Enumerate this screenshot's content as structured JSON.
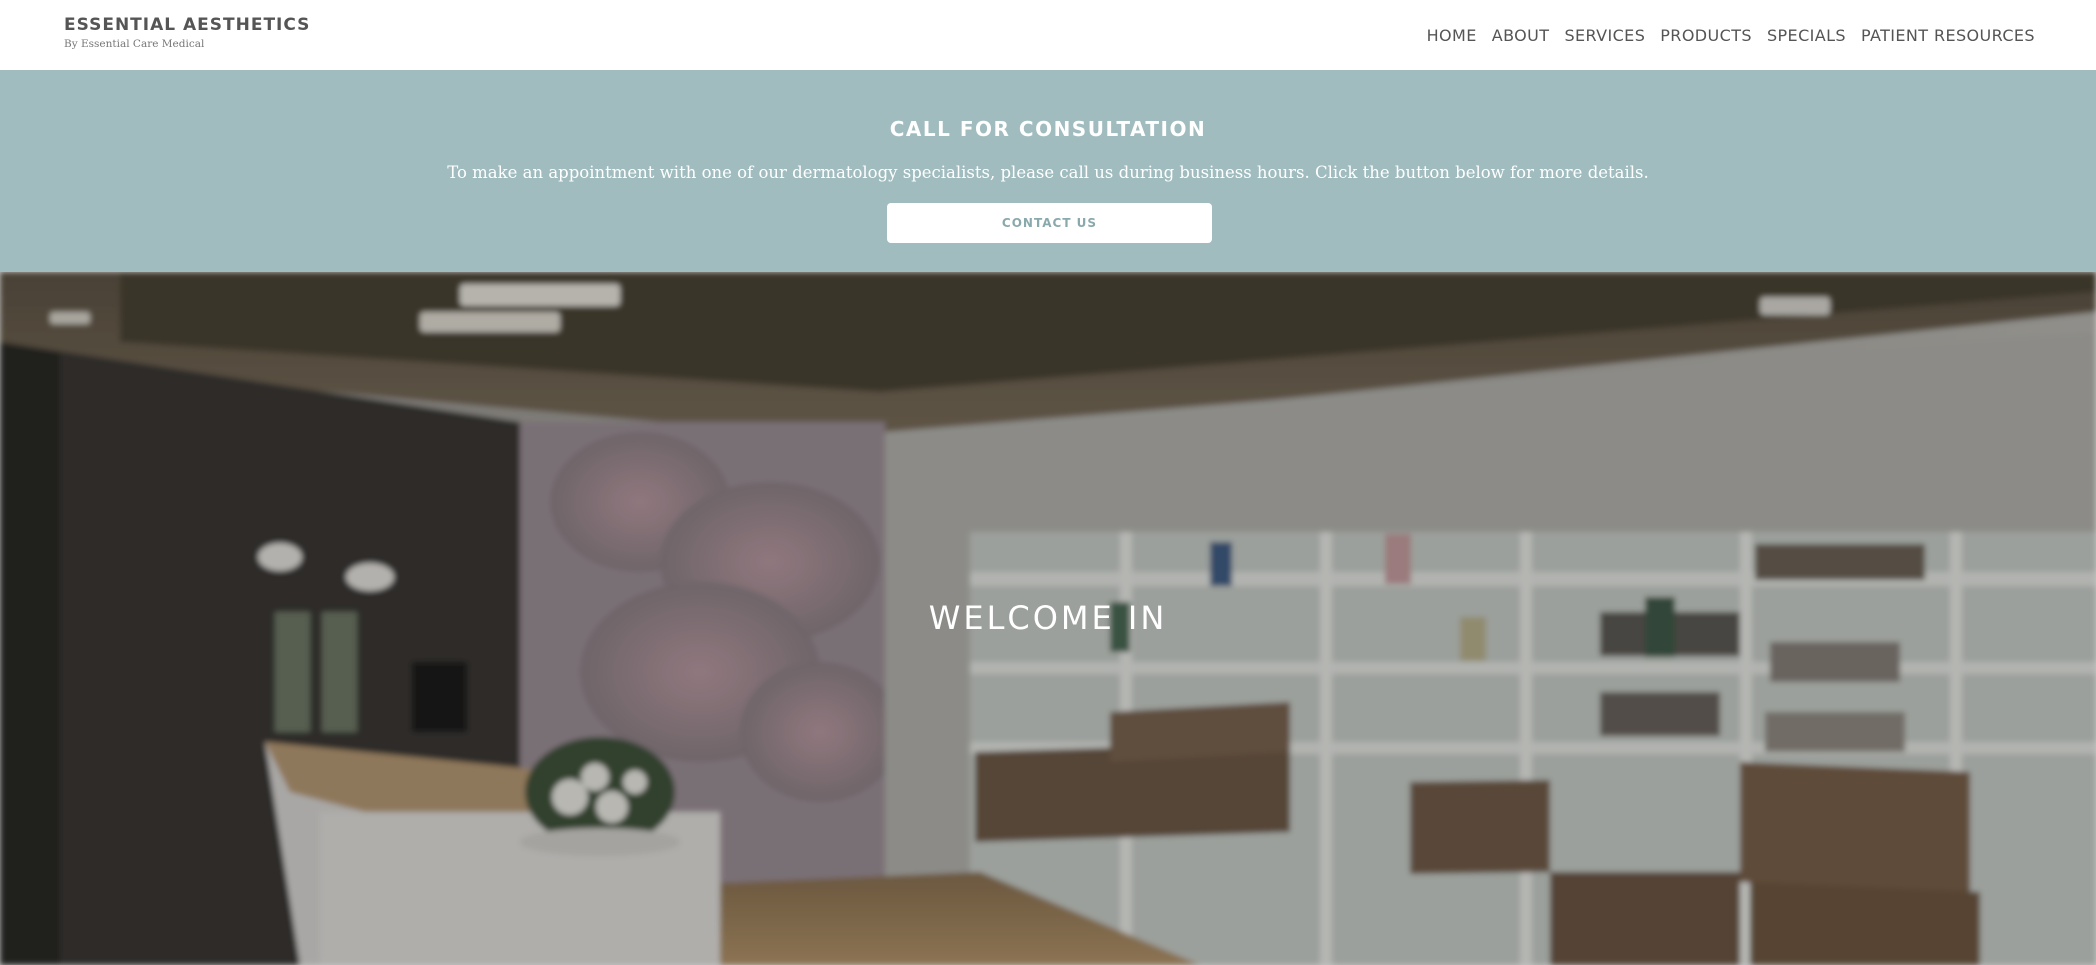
{
  "header": {
    "brand_name": "ESSENTIAL AESTHETICS",
    "brand_tagline": "By Essential Care Medical",
    "nav": [
      "HOME",
      "ABOUT",
      "SERVICES",
      "PRODUCTS",
      "SPECIALS",
      "PATIENT RESOURCES"
    ]
  },
  "consultation": {
    "title": "CALL FOR CONSULTATION",
    "text": "To make an appointment with one of our dermatology specialists, please call us during business hours. Click the button below for more details.",
    "button_label": "CONTACT US",
    "background_color": "#a0bcbf"
  },
  "hero": {
    "title": "WELCOME IN",
    "image": "blurred-clinic-reception-photo"
  }
}
